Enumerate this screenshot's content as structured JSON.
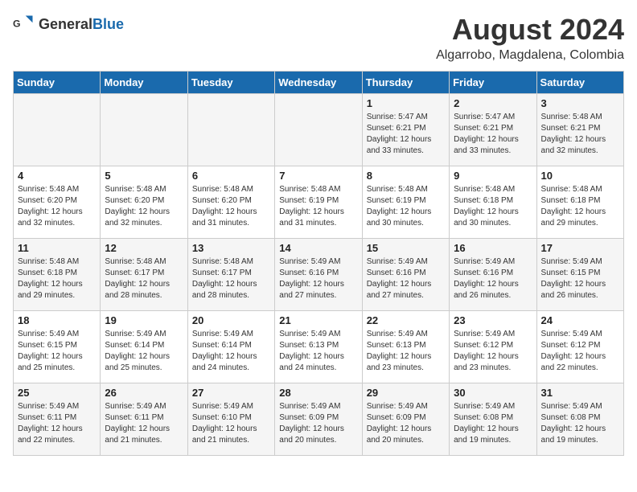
{
  "header": {
    "logo_general": "General",
    "logo_blue": "Blue",
    "month_year": "August 2024",
    "location": "Algarrobo, Magdalena, Colombia"
  },
  "weekdays": [
    "Sunday",
    "Monday",
    "Tuesday",
    "Wednesday",
    "Thursday",
    "Friday",
    "Saturday"
  ],
  "weeks": [
    [
      {
        "day": "",
        "content": ""
      },
      {
        "day": "",
        "content": ""
      },
      {
        "day": "",
        "content": ""
      },
      {
        "day": "",
        "content": ""
      },
      {
        "day": "1",
        "content": "Sunrise: 5:47 AM\nSunset: 6:21 PM\nDaylight: 12 hours\nand 33 minutes."
      },
      {
        "day": "2",
        "content": "Sunrise: 5:47 AM\nSunset: 6:21 PM\nDaylight: 12 hours\nand 33 minutes."
      },
      {
        "day": "3",
        "content": "Sunrise: 5:48 AM\nSunset: 6:21 PM\nDaylight: 12 hours\nand 32 minutes."
      }
    ],
    [
      {
        "day": "4",
        "content": "Sunrise: 5:48 AM\nSunset: 6:20 PM\nDaylight: 12 hours\nand 32 minutes."
      },
      {
        "day": "5",
        "content": "Sunrise: 5:48 AM\nSunset: 6:20 PM\nDaylight: 12 hours\nand 32 minutes."
      },
      {
        "day": "6",
        "content": "Sunrise: 5:48 AM\nSunset: 6:20 PM\nDaylight: 12 hours\nand 31 minutes."
      },
      {
        "day": "7",
        "content": "Sunrise: 5:48 AM\nSunset: 6:19 PM\nDaylight: 12 hours\nand 31 minutes."
      },
      {
        "day": "8",
        "content": "Sunrise: 5:48 AM\nSunset: 6:19 PM\nDaylight: 12 hours\nand 30 minutes."
      },
      {
        "day": "9",
        "content": "Sunrise: 5:48 AM\nSunset: 6:18 PM\nDaylight: 12 hours\nand 30 minutes."
      },
      {
        "day": "10",
        "content": "Sunrise: 5:48 AM\nSunset: 6:18 PM\nDaylight: 12 hours\nand 29 minutes."
      }
    ],
    [
      {
        "day": "11",
        "content": "Sunrise: 5:48 AM\nSunset: 6:18 PM\nDaylight: 12 hours\nand 29 minutes."
      },
      {
        "day": "12",
        "content": "Sunrise: 5:48 AM\nSunset: 6:17 PM\nDaylight: 12 hours\nand 28 minutes."
      },
      {
        "day": "13",
        "content": "Sunrise: 5:48 AM\nSunset: 6:17 PM\nDaylight: 12 hours\nand 28 minutes."
      },
      {
        "day": "14",
        "content": "Sunrise: 5:49 AM\nSunset: 6:16 PM\nDaylight: 12 hours\nand 27 minutes."
      },
      {
        "day": "15",
        "content": "Sunrise: 5:49 AM\nSunset: 6:16 PM\nDaylight: 12 hours\nand 27 minutes."
      },
      {
        "day": "16",
        "content": "Sunrise: 5:49 AM\nSunset: 6:16 PM\nDaylight: 12 hours\nand 26 minutes."
      },
      {
        "day": "17",
        "content": "Sunrise: 5:49 AM\nSunset: 6:15 PM\nDaylight: 12 hours\nand 26 minutes."
      }
    ],
    [
      {
        "day": "18",
        "content": "Sunrise: 5:49 AM\nSunset: 6:15 PM\nDaylight: 12 hours\nand 25 minutes."
      },
      {
        "day": "19",
        "content": "Sunrise: 5:49 AM\nSunset: 6:14 PM\nDaylight: 12 hours\nand 25 minutes."
      },
      {
        "day": "20",
        "content": "Sunrise: 5:49 AM\nSunset: 6:14 PM\nDaylight: 12 hours\nand 24 minutes."
      },
      {
        "day": "21",
        "content": "Sunrise: 5:49 AM\nSunset: 6:13 PM\nDaylight: 12 hours\nand 24 minutes."
      },
      {
        "day": "22",
        "content": "Sunrise: 5:49 AM\nSunset: 6:13 PM\nDaylight: 12 hours\nand 23 minutes."
      },
      {
        "day": "23",
        "content": "Sunrise: 5:49 AM\nSunset: 6:12 PM\nDaylight: 12 hours\nand 23 minutes."
      },
      {
        "day": "24",
        "content": "Sunrise: 5:49 AM\nSunset: 6:12 PM\nDaylight: 12 hours\nand 22 minutes."
      }
    ],
    [
      {
        "day": "25",
        "content": "Sunrise: 5:49 AM\nSunset: 6:11 PM\nDaylight: 12 hours\nand 22 minutes."
      },
      {
        "day": "26",
        "content": "Sunrise: 5:49 AM\nSunset: 6:11 PM\nDaylight: 12 hours\nand 21 minutes."
      },
      {
        "day": "27",
        "content": "Sunrise: 5:49 AM\nSunset: 6:10 PM\nDaylight: 12 hours\nand 21 minutes."
      },
      {
        "day": "28",
        "content": "Sunrise: 5:49 AM\nSunset: 6:09 PM\nDaylight: 12 hours\nand 20 minutes."
      },
      {
        "day": "29",
        "content": "Sunrise: 5:49 AM\nSunset: 6:09 PM\nDaylight: 12 hours\nand 20 minutes."
      },
      {
        "day": "30",
        "content": "Sunrise: 5:49 AM\nSunset: 6:08 PM\nDaylight: 12 hours\nand 19 minutes."
      },
      {
        "day": "31",
        "content": "Sunrise: 5:49 AM\nSunset: 6:08 PM\nDaylight: 12 hours\nand 19 minutes."
      }
    ]
  ]
}
